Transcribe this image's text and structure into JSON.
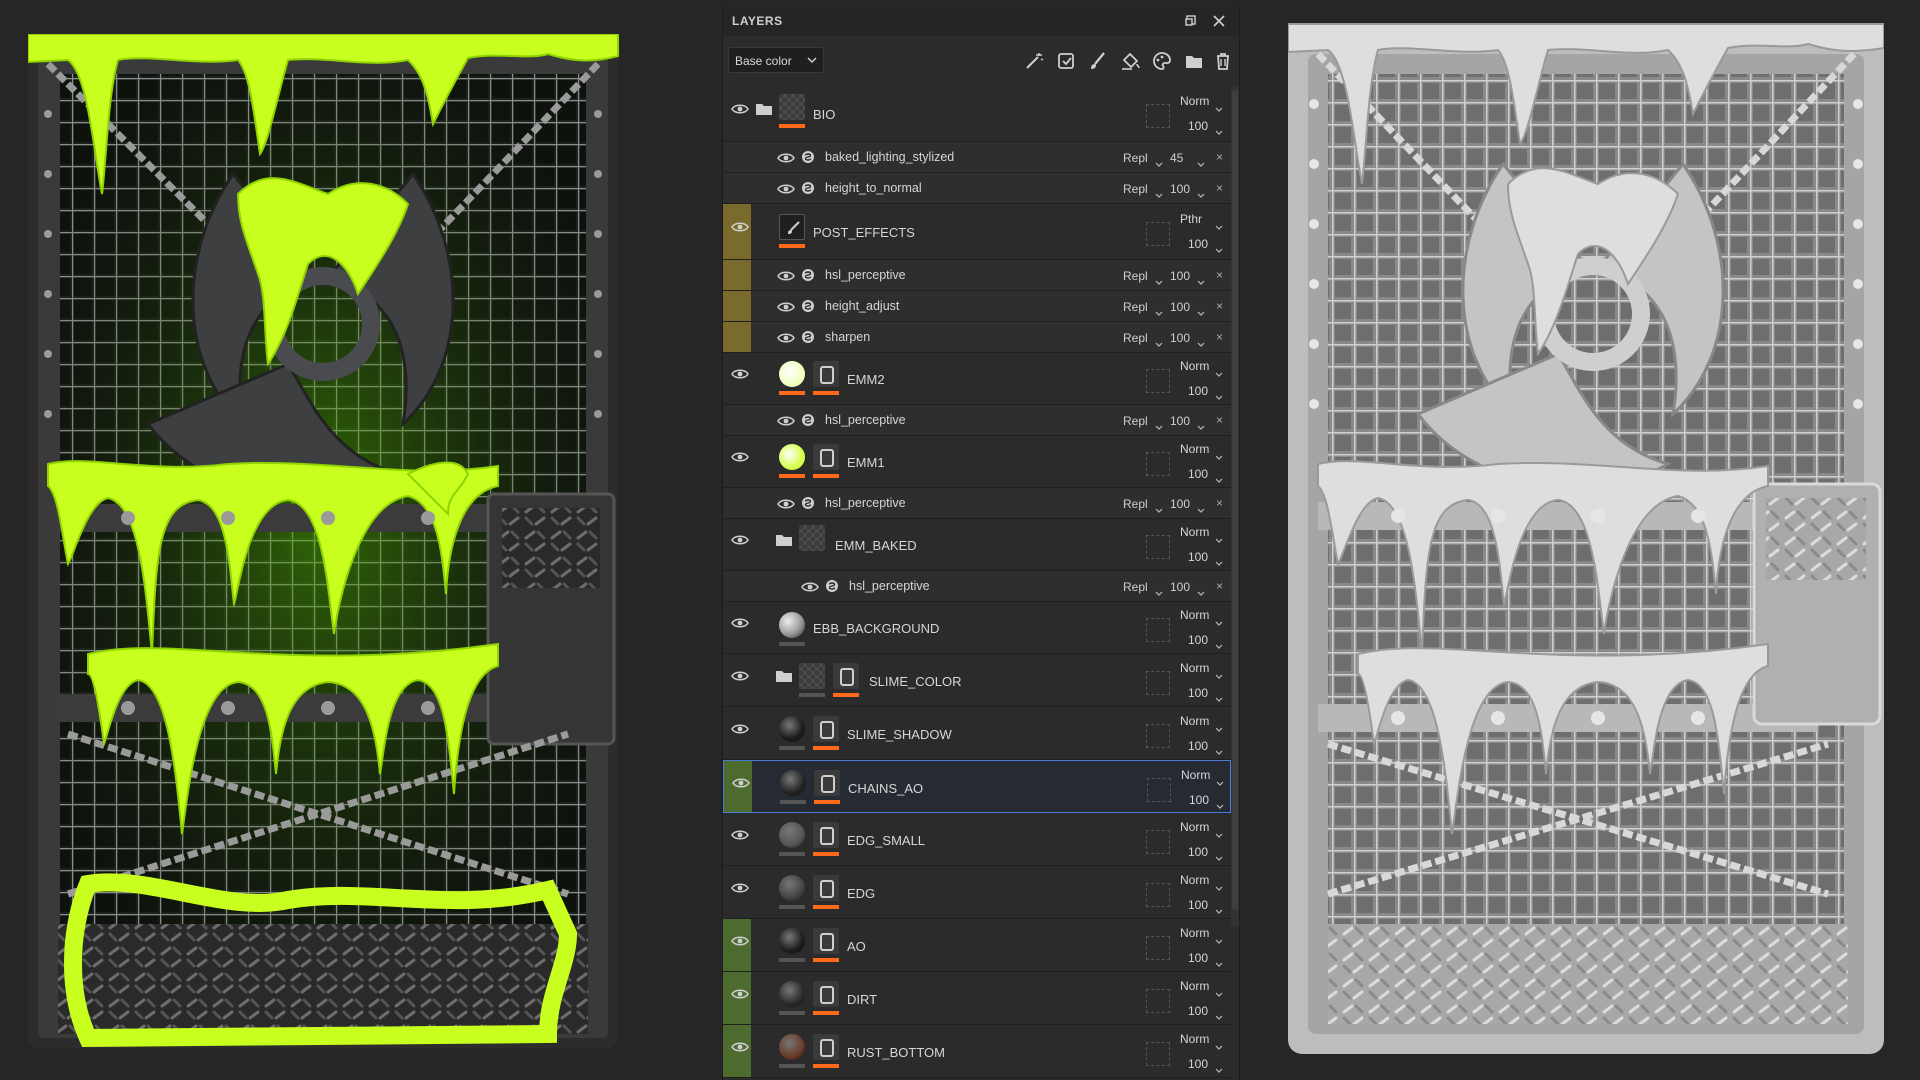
{
  "panel": {
    "title": "LAYERS",
    "channel": "Base color"
  },
  "icons": {
    "header": [
      "maximize-icon",
      "close-icon"
    ],
    "tools": [
      "magic-wand-icon",
      "add-fill-icon",
      "brush-icon",
      "paint-bucket-icon",
      "palette-icon",
      "folder-icon",
      "trash-icon"
    ]
  },
  "layers": [
    {
      "name": "BIO",
      "kind": "folder",
      "blend": "Norm",
      "opacity": "100",
      "gutter": "",
      "thumb": "checker",
      "accent": "#ff4500",
      "effects": [
        {
          "name": "baked_lighting_stylized",
          "blend": "Repl",
          "opacity": "45"
        },
        {
          "name": "height_to_normal",
          "blend": "Repl",
          "opacity": "100"
        }
      ]
    },
    {
      "name": "POST_EFFECTS",
      "kind": "paint",
      "blend": "Pthr",
      "opacity": "100",
      "gutter": "olive",
      "effects": [
        {
          "name": "hsl_perceptive",
          "blend": "Repl",
          "opacity": "100"
        },
        {
          "name": "height_adjust",
          "blend": "Repl",
          "opacity": "100"
        },
        {
          "name": "sharpen",
          "blend": "Repl",
          "opacity": "100"
        }
      ]
    },
    {
      "name": "EMM2",
      "kind": "fill",
      "blend": "Norm",
      "opacity": "100",
      "gutter": "",
      "thumbColor": "#efffc0",
      "effects": [
        {
          "name": "hsl_perceptive",
          "blend": "Repl",
          "opacity": "100"
        }
      ]
    },
    {
      "name": "EMM1",
      "kind": "fill",
      "blend": "Norm",
      "opacity": "100",
      "gutter": "",
      "thumbColor": "#d6ff4a",
      "effects": [
        {
          "name": "hsl_perceptive",
          "blend": "Repl",
          "opacity": "100"
        }
      ]
    },
    {
      "name": "EMM_BAKED",
      "kind": "folder-checker",
      "blend": "Norm",
      "opacity": "100",
      "gutter": "",
      "effects": [
        {
          "name": "hsl_perceptive",
          "blend": "Repl",
          "opacity": "100"
        }
      ]
    },
    {
      "name": "EBB_BACKGROUND",
      "kind": "sphere",
      "blend": "Norm",
      "opacity": "100",
      "gutter": "",
      "thumbColor": "#9a9a9a",
      "effects": []
    },
    {
      "name": "SLIME_COLOR",
      "kind": "folder-mask",
      "blend": "Norm",
      "opacity": "100",
      "gutter": "",
      "effects": []
    },
    {
      "name": "SLIME_SHADOW",
      "kind": "fill-mask",
      "blend": "Norm",
      "opacity": "100",
      "gutter": "",
      "thumbColor": "#1a1a1a",
      "effects": []
    },
    {
      "name": "CHAINS_AO",
      "kind": "fill-mask",
      "blend": "Norm",
      "opacity": "100",
      "gutter": "green",
      "thumbColor": "#222",
      "selected": true,
      "effects": []
    },
    {
      "name": "EDG_SMALL",
      "kind": "fill-mask",
      "blend": "Norm",
      "opacity": "100",
      "gutter": "",
      "thumbColor": "#555",
      "effects": []
    },
    {
      "name": "EDG",
      "kind": "fill-mask",
      "blend": "Norm",
      "opacity": "100",
      "gutter": "",
      "thumbColor": "#444",
      "effects": []
    },
    {
      "name": "AO",
      "kind": "fill-mask",
      "blend": "Norm",
      "opacity": "100",
      "gutter": "green",
      "thumbColor": "#1c1c1c",
      "effects": []
    },
    {
      "name": "DIRT",
      "kind": "fill-mask",
      "blend": "Norm",
      "opacity": "100",
      "gutter": "green",
      "thumbColor": "#2a2a2a",
      "effects": []
    },
    {
      "name": "RUST_BOTTOM",
      "kind": "fill-mask",
      "blend": "Norm",
      "opacity": "100",
      "gutter": "green",
      "thumbColor": "#6b3a28",
      "effects": []
    }
  ],
  "colors": {
    "accent": "#ff6a1a",
    "selection": "#4a7bd6",
    "slime": "#c8ff1e"
  }
}
